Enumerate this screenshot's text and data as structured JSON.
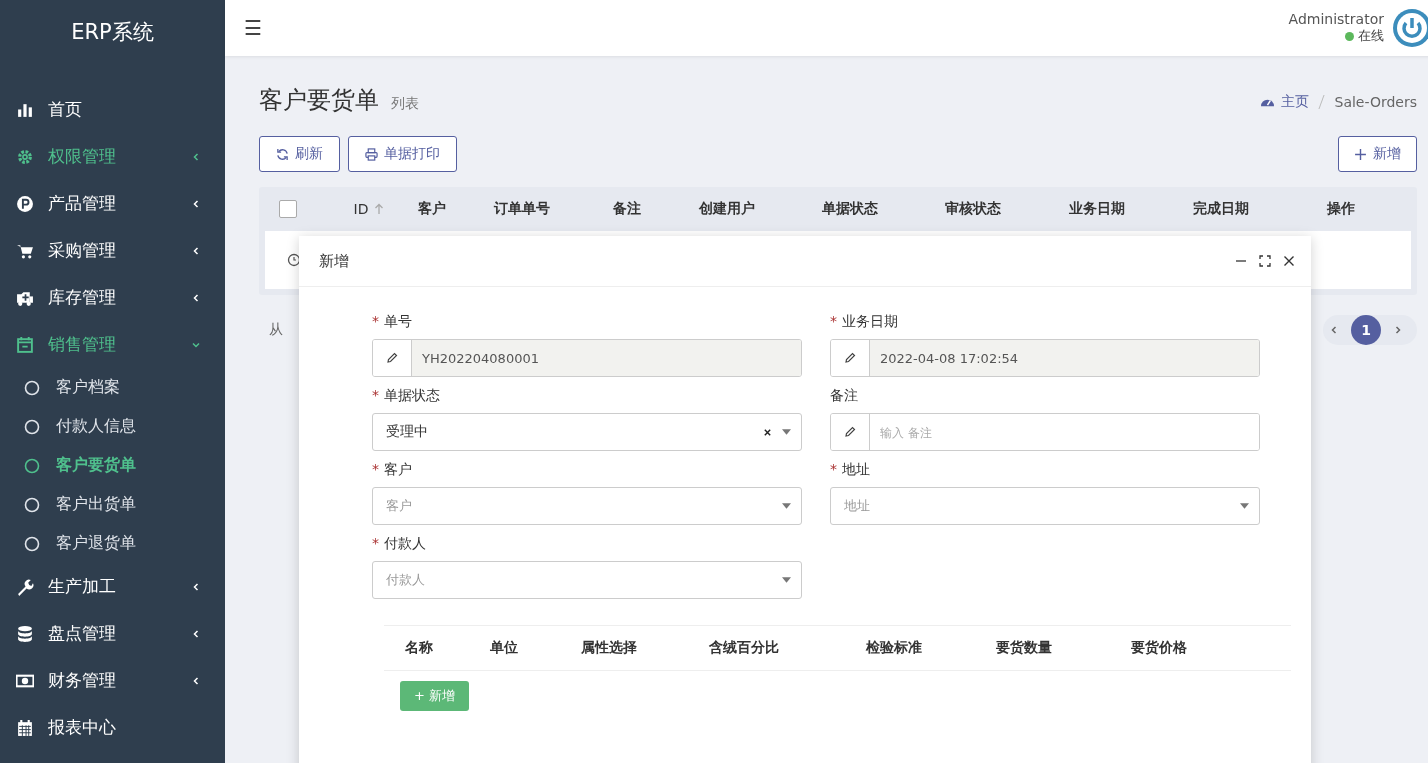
{
  "sidebar": {
    "title": "ERP系统",
    "items": [
      {
        "label": "首页",
        "kind": "link",
        "selected": false
      },
      {
        "label": "权限管理",
        "kind": "group",
        "selected": true,
        "expanded": false
      },
      {
        "label": "产品管理",
        "kind": "group",
        "selected": false,
        "expanded": false
      },
      {
        "label": "采购管理",
        "kind": "group",
        "selected": false,
        "expanded": false
      },
      {
        "label": "库存管理",
        "kind": "group",
        "selected": false,
        "expanded": false
      },
      {
        "label": "销售管理",
        "kind": "group",
        "selected": true,
        "expanded": true,
        "children": [
          {
            "label": "客户档案",
            "selected": false
          },
          {
            "label": "付款人信息",
            "selected": false
          },
          {
            "label": "客户要货单",
            "selected": true
          },
          {
            "label": "客户出货单",
            "selected": false
          },
          {
            "label": "客户退货单",
            "selected": false
          }
        ]
      },
      {
        "label": "生产加工",
        "kind": "group",
        "selected": false,
        "expanded": false
      },
      {
        "label": "盘点管理",
        "kind": "group",
        "selected": false,
        "expanded": false
      },
      {
        "label": "财务管理",
        "kind": "group",
        "selected": false,
        "expanded": false
      },
      {
        "label": "报表中心",
        "kind": "link",
        "selected": false
      }
    ]
  },
  "header": {
    "menu_icon": "☰",
    "user": "Administrator",
    "status": {
      "label": "在线",
      "color": "#5cb85c"
    }
  },
  "page": {
    "title": "客户要货单",
    "subtitle": "列表",
    "breadcrumb": [
      "主页",
      "Sale-Orders"
    ]
  },
  "toolbar": {
    "left": [
      "刷新",
      "单据打印"
    ],
    "right": "新增"
  },
  "table": {
    "select_all": {
      "checked": false
    },
    "columns": [
      "ID",
      "客户",
      "订单单号",
      "备注",
      "创建用户",
      "单据状态",
      "审核状态",
      "业务日期",
      "完成日期",
      "操作"
    ]
  },
  "pagination": {
    "info": "从",
    "pages": [
      {
        "label": "1",
        "selected": true
      }
    ]
  },
  "modal": {
    "title": "新增",
    "fields": [
      {
        "label": "单号",
        "required_mark": "*",
        "kind": "readonly",
        "value": "YH202204080001"
      },
      {
        "label": "业务日期",
        "required_mark": "*",
        "kind": "readonly",
        "value": "2022-04-08 17:02:54"
      },
      {
        "label": "单据状态",
        "required_mark": "*",
        "kind": "select",
        "value": "受理中"
      },
      {
        "label": "备注",
        "kind": "text",
        "placeholder": "输入 备注"
      },
      {
        "label": "客户",
        "required_mark": "*",
        "kind": "select",
        "placeholder": "客户"
      },
      {
        "label": "地址",
        "required_mark": "*",
        "kind": "select",
        "placeholder": "地址"
      },
      {
        "label": "付款人",
        "required_mark": "*",
        "kind": "select",
        "placeholder": "付款人"
      }
    ],
    "detail_columns": [
      "名称",
      "单位",
      "属性选择",
      "含绒百分比",
      "检验标准",
      "要货数量",
      "要货价格"
    ],
    "add_button": "+ 新增"
  }
}
